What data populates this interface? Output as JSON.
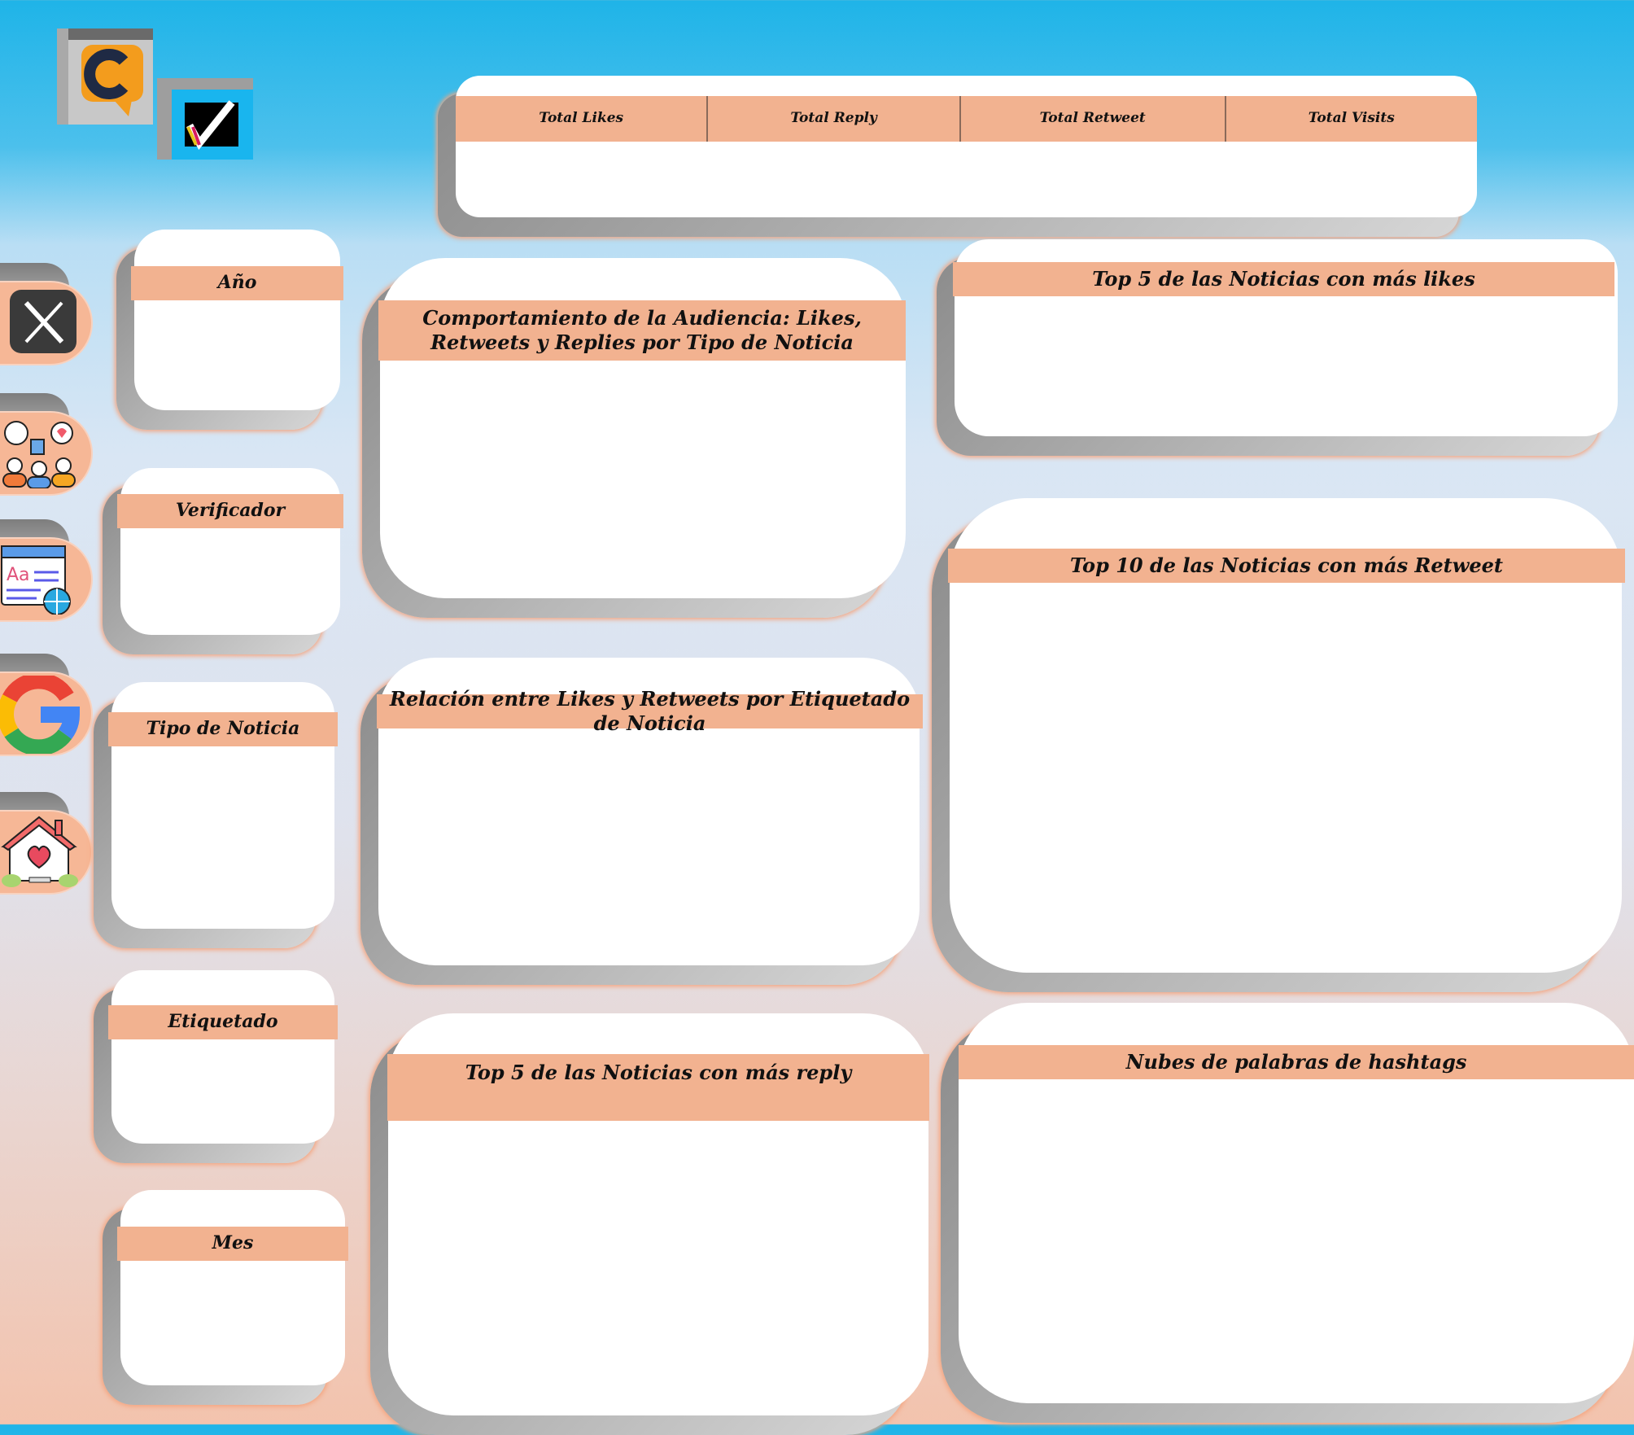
{
  "logos": {
    "c_logo": "c-logo-icon",
    "check_logo": "verificador-logo-icon"
  },
  "sidebar": [
    {
      "icon": "x-twitter-icon"
    },
    {
      "icon": "audience-icon"
    },
    {
      "icon": "web-article-icon"
    },
    {
      "icon": "google-icon"
    },
    {
      "icon": "home-heart-icon"
    }
  ],
  "kpis": {
    "likes": "Total Likes",
    "reply": "Total Reply",
    "retweet": "Total  Retweet",
    "visits": "Total Visits"
  },
  "filters": {
    "anio": "Año",
    "verificador": "Verificador",
    "tipo": "Tipo de Noticia",
    "etiquetado": "Etiquetado",
    "mes": "Mes"
  },
  "charts": {
    "comportamiento": "Comportamiento de la Audiencia: Likes, Retweets y Replies por Tipo de Noticia",
    "relacion": "Relación entre Likes y Retweets por Etiquetado de Noticia",
    "top5_reply": "Top 5 de las Noticias con más reply",
    "top5_likes": "Top 5 de las Noticias con más likes",
    "top10_retweet": "Top 10 de las Noticias con más Retweet",
    "nubes": "Nubes de palabras de hashtags"
  },
  "colors": {
    "accent": "#f2b290",
    "bg_top": "#1fb4e8",
    "bg_bottom": "#f3c3ad"
  }
}
